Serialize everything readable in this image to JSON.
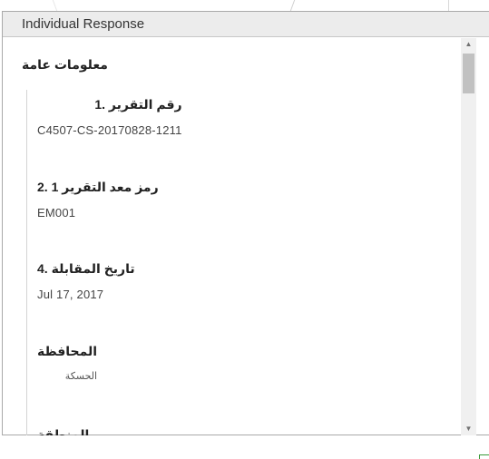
{
  "panel": {
    "title": "Individual Response"
  },
  "section": {
    "title": "معلومات عامة"
  },
  "fields": [
    {
      "label": "رقم التقرير .1",
      "value": "C4507-CS-20170828-1211"
    },
    {
      "label": "رمز معد التقرير 1 .2",
      "value": "EM001"
    },
    {
      "label": "تاريخ المقابلة .4",
      "value": "Jul 17, 2017"
    },
    {
      "label": "المحافظة",
      "value": "الحسكة"
    },
    {
      "label": "المنطقة",
      "value": ""
    }
  ],
  "scrollbar": {
    "up_icon": "triangle-up",
    "down_icon": "triangle-down"
  }
}
